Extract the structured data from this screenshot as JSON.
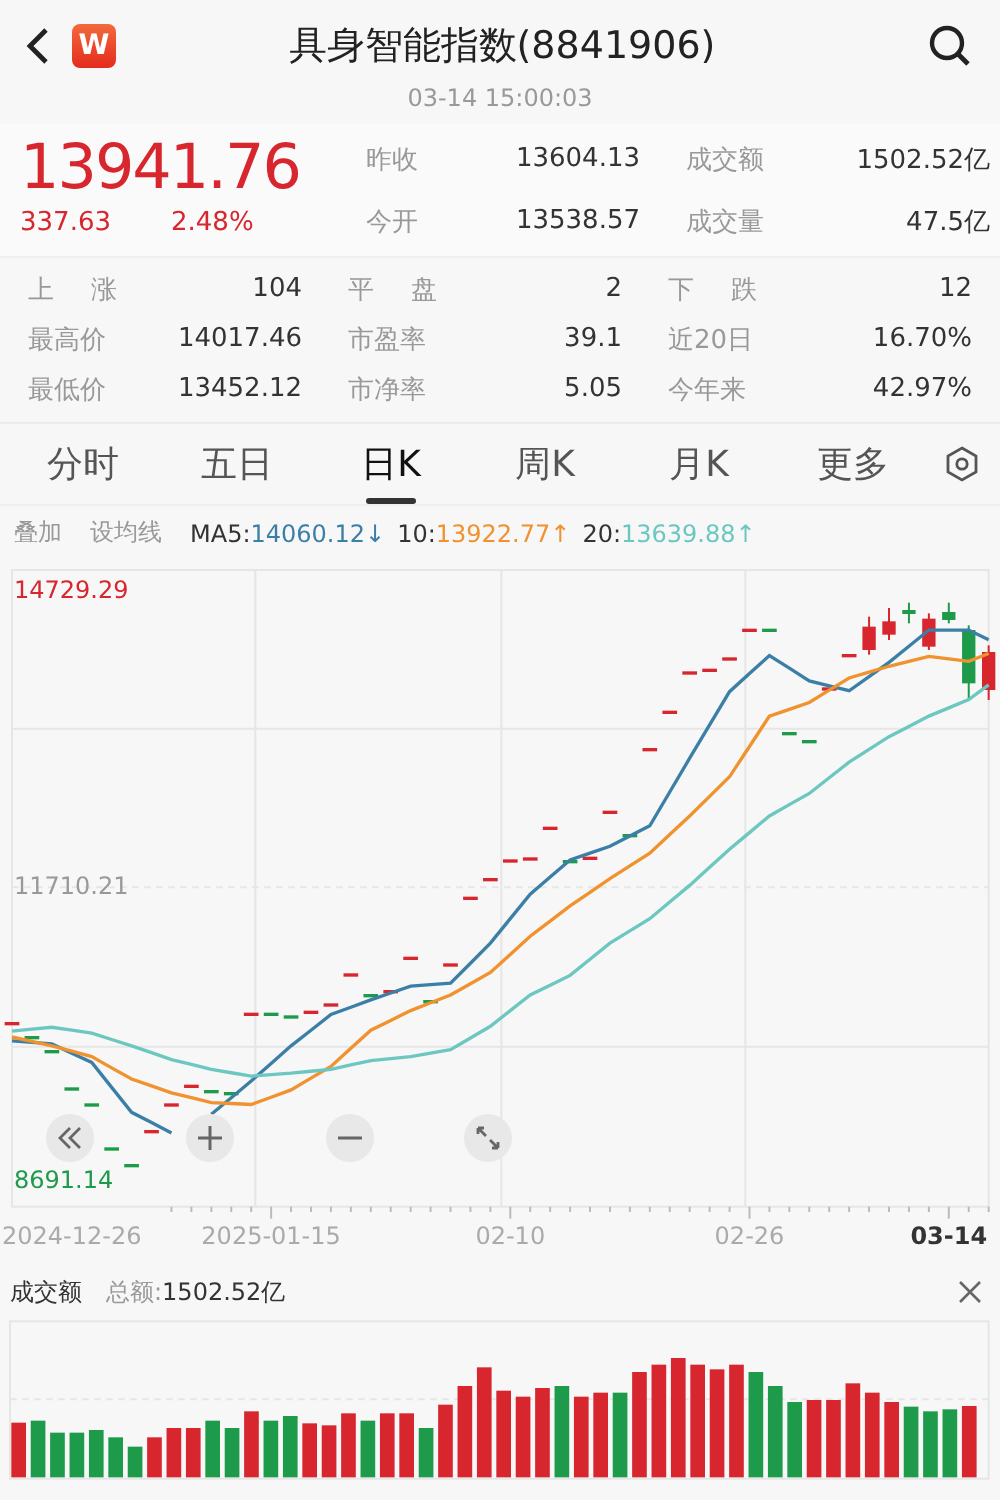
{
  "header": {
    "logo_text": "W",
    "title": "具身智能指数(8841906)",
    "time": "03-14 15:00:03"
  },
  "quote": {
    "price": "13941.76",
    "change": "337.63",
    "change_pct": "2.48%",
    "side_stats": [
      {
        "label": "昨收",
        "value": "13604.13"
      },
      {
        "label": "成交额",
        "value": "1502.52亿"
      },
      {
        "label": "今开",
        "value": "13538.57"
      },
      {
        "label": "成交量",
        "value": "47.5亿"
      }
    ]
  },
  "stats": [
    {
      "label": "上 涨",
      "value": "104"
    },
    {
      "label": "平 盘",
      "value": "2"
    },
    {
      "label": "下 跌",
      "value": "12"
    },
    {
      "label": "最高价",
      "value": "14017.46"
    },
    {
      "label": "市盈率",
      "value": "39.1"
    },
    {
      "label": "近20日",
      "value": "16.70%"
    },
    {
      "label": "最低价",
      "value": "13452.12"
    },
    {
      "label": "市净率",
      "value": "5.05"
    },
    {
      "label": "今年来",
      "value": "42.97%"
    }
  ],
  "tabs": [
    {
      "label": "分时",
      "selected": false
    },
    {
      "label": "五日",
      "selected": false
    },
    {
      "label": "日K",
      "selected": true
    },
    {
      "label": "周K",
      "selected": false
    },
    {
      "label": "月K",
      "selected": false
    },
    {
      "label": "更多",
      "selected": false
    }
  ],
  "ma_bar": {
    "buttons": [
      "叠加",
      "设均线"
    ],
    "indicators": [
      {
        "value": "14060.12",
        "arrow": "↓"
      },
      {
        "value": "13922.77",
        "arrow": "↑"
      },
      {
        "value": "13639.88",
        "arrow": "↑"
      }
    ]
  },
  "price_chart": {
    "chart_data": {
      "type": "line",
      "categories": [
        null,
        null,
        null,
        "2024-12-26",
        null,
        null,
        null,
        null,
        null,
        null,
        null,
        null,
        null,
        "2025-01-15",
        null,
        null,
        null,
        null,
        null,
        null,
        null,
        null,
        null,
        null,
        null,
        "02-10",
        null,
        null,
        null,
        null,
        null,
        null,
        null,
        null,
        null,
        null,
        null,
        "02-26",
        null,
        null,
        null,
        null,
        null,
        null,
        null,
        null,
        null,
        "03-14",
        null,
        null
      ],
      "ylim": [
        8446,
        14954
      ],
      "ref_lines": [
        {
          "axis": "y",
          "value": 11710.21
        }
      ],
      "yticks": [
        {
          "value": 14729.29,
          "label": "14729.29"
        },
        {
          "value": 11710.21,
          "label": "11710.21"
        },
        {
          "value": 8691.14,
          "label": "8691.14"
        }
      ],
      "series": [
        {
          "name": "MA5:",
          "color": "#3b7fa6",
          "values": [
            10140,
            10125,
            10110,
            10015,
            9920,
            9665,
            9410,
            9305,
            9200,
            null,
            9390,
            9560,
            9730,
            9910,
            10090,
            10250,
            10410,
            10485,
            10560,
            10630,
            10700,
            10715,
            10730,
            10935,
            11140,
            11390,
            11640,
            11815,
            11990,
            12060,
            12130,
            12235,
            12340,
            12685,
            13030,
            13370,
            13710,
            13895,
            14080,
            13950,
            13820,
            13770,
            13720,
            13865,
            14010,
            14175,
            14340,
            14340,
            14340,
            14240
          ]
        },
        {
          "name": "10:",
          "color": "#f0922e",
          "values": [
            10180,
            10135,
            10090,
            10035,
            9980,
            9865,
            9750,
            9680,
            9610,
            9560,
            9510,
            9500,
            9490,
            9565,
            9640,
            9760,
            9880,
            10065,
            10250,
            10350,
            10450,
            10530,
            10610,
            10725,
            10840,
            11025,
            11210,
            11365,
            11520,
            11660,
            11800,
            11930,
            12060,
            12250,
            12440,
            12640,
            12840,
            13150,
            13460,
            13530,
            13600,
            13725,
            13850,
            13910,
            13970,
            14020,
            14070,
            14045,
            14020,
            14100
          ]
        },
        {
          "name": "20:",
          "color": "#6cc7c0",
          "values": [
            10240,
            10260,
            10280,
            10250,
            10220,
            10155,
            10090,
            10020,
            9950,
            9900,
            9850,
            9815,
            9780,
            9795,
            9810,
            9830,
            9850,
            9895,
            9940,
            9960,
            9980,
            10015,
            10050,
            10170,
            10290,
            10450,
            10610,
            10710,
            10810,
            10975,
            11140,
            11265,
            11390,
            11560,
            11730,
            11915,
            12100,
            12270,
            12440,
            12555,
            12670,
            12830,
            12990,
            13120,
            13250,
            13355,
            13460,
            13545,
            13630,
            13780
          ]
        }
      ]
    }
  },
  "volume": {
    "title": "成交额",
    "total_label": "总额:",
    "total": "1502.52亿"
  }
}
